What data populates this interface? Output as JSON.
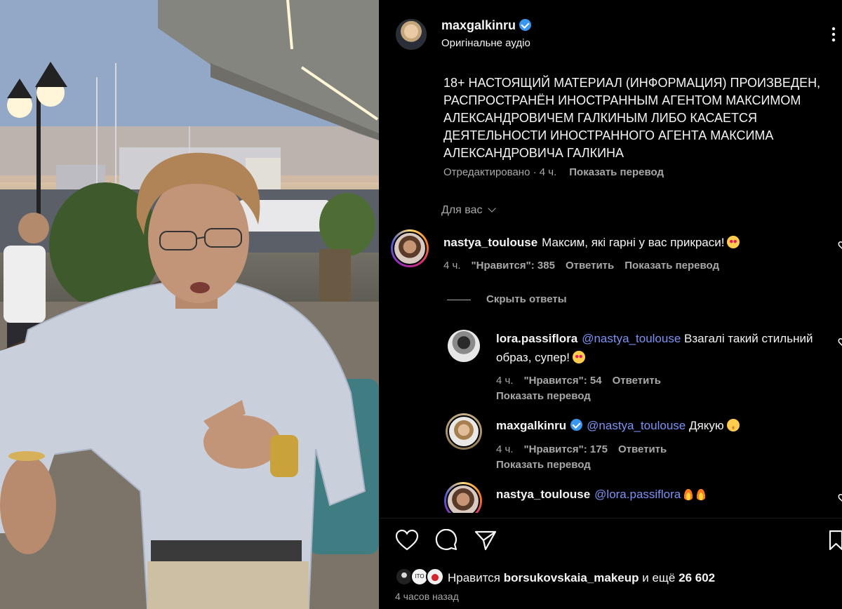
{
  "post": {
    "username": "maxgalkinru",
    "audio": "Оригінальне аудіо",
    "caption": "18+ НАСТОЯЩИЙ МАТЕРИАЛ (ИНФОРМАЦИЯ) ПРОИЗВЕДЕН, РАСПРОСТРАНЁН ИНОСТРАННЫМ АГЕНТОМ МАКСИМОМ АЛЕКСАНДРОВИЧЕМ ГАЛКИНЫМ ЛИБО КАСАЕТСЯ ДЕЯТЕЛЬНОСТИ ИНОСТРАННОГО АГЕНТА МАКСИМА АЛЕКСАНДРОВИЧА ГАЛКИНА",
    "edited": "Отредактировано · 4 ч.",
    "show_translation": "Показать перевод"
  },
  "filter": {
    "label": "Для вас"
  },
  "comments": [
    {
      "username": "nastya_toulouse",
      "text": "Максим, які гарні у вас прикраси!",
      "emoji": "heart-eyes",
      "time": "4 ч.",
      "likes": "\"Нравится\": 385",
      "reply": "Ответить",
      "translate": "Показать перевод",
      "hide_replies": "Скрыть ответы",
      "replies": [
        {
          "username": "lora.passiflora",
          "mention": "@nastya_toulouse",
          "text": "Взагалі такий стильний образ, супер!",
          "emoji": "heart-eyes",
          "time": "4 ч.",
          "likes": "\"Нравится\": 54",
          "reply": "Ответить",
          "translate": "Показать перевод"
        },
        {
          "username": "maxgalkinru",
          "mention": "@nastya_toulouse",
          "text": "Дякую",
          "emoji": "relieved",
          "time": "4 ч.",
          "likes": "\"Нравится\": 175",
          "reply": "Ответить",
          "translate": "Показать перевод"
        },
        {
          "username": "nastya_toulouse",
          "mention": "@lora.passiflora",
          "text": "",
          "emoji": "fire-fire"
        }
      ]
    }
  ],
  "footer": {
    "liked_prefix": "Нравится",
    "liked_user": "borsukovskaia_makeup",
    "liked_suffix": "и ещё",
    "liked_count": "26 602",
    "time_ago": "4 часов назад"
  },
  "icons": [
    "heart-icon",
    "comment-icon",
    "share-icon",
    "bookmark-icon",
    "more-icon",
    "verified-icon",
    "chevron-down-icon"
  ],
  "colors": {
    "accent_link": "#7b93f5",
    "verified": "#3897f0",
    "muted": "#a8a8a8"
  }
}
